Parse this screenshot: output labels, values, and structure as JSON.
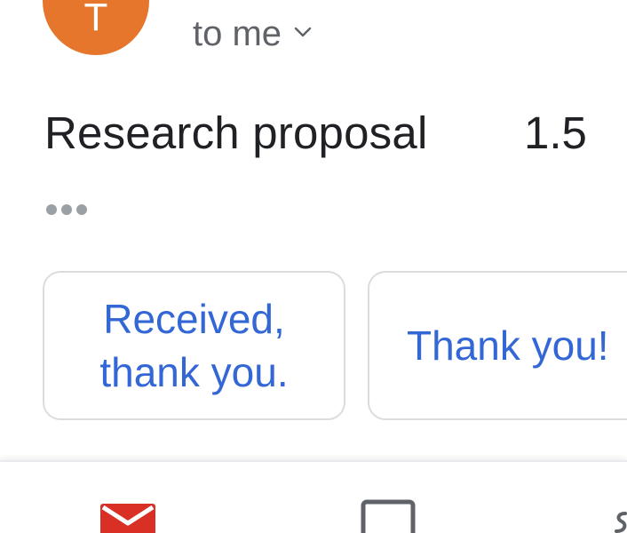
{
  "sender": {
    "avatar_initial": "T",
    "avatar_color": "#e5762c"
  },
  "header": {
    "recipient_text": "to me",
    "recipient_toggle_icon": "chevron-down-icon"
  },
  "message": {
    "subject": "Research proposal",
    "subject_suffix": "1.5",
    "more_icon": "more-horiz-icon"
  },
  "smart_replies": [
    {
      "label": "Received, thank you."
    },
    {
      "label": "Thank you!"
    }
  ],
  "bottom_nav": {
    "items": [
      {
        "icon": "mail-icon",
        "color": "#d93025"
      },
      {
        "icon": "square-icon",
        "color": "#5f6368"
      },
      {
        "icon": "partial-nav-icon",
        "color": "#5f6368"
      }
    ]
  },
  "colors": {
    "link_blue": "#3367d6",
    "text_dark": "#202124",
    "text_gray": "#5f6368",
    "chip_border": "#dadce0"
  }
}
